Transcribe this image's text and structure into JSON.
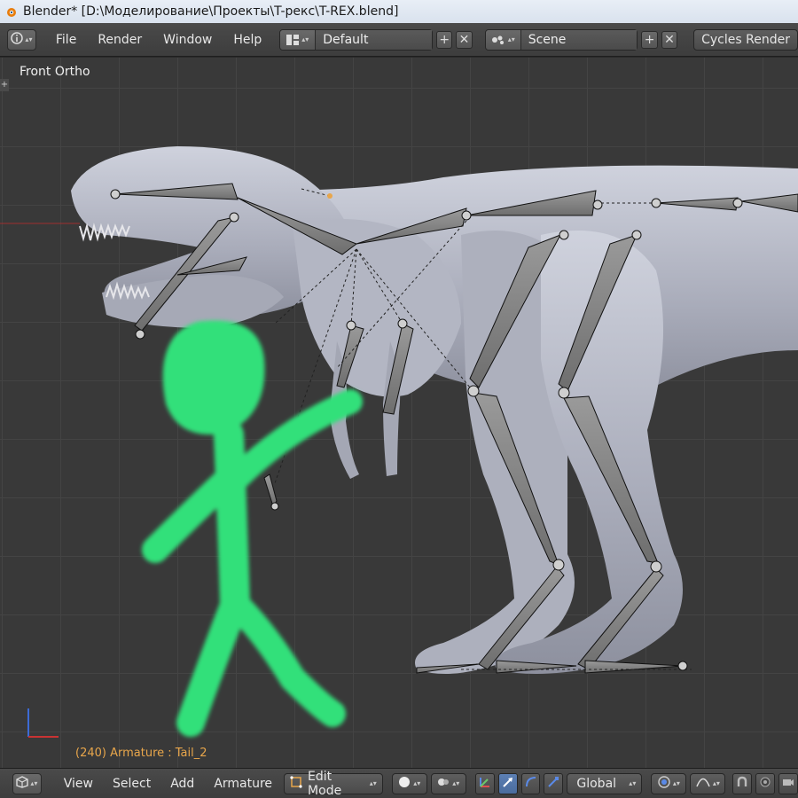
{
  "window": {
    "title": "Blender* [D:\\Моделирование\\Проекты\\T-рекс\\T-REX.blend]"
  },
  "top_menu": {
    "items": [
      "File",
      "Render",
      "Window",
      "Help"
    ],
    "screen_layout": "Default",
    "scene": "Scene",
    "render_engine": "Cycles Render"
  },
  "viewport": {
    "view_name": "Front Ortho",
    "object_info": "(240) Armature : Tail_2"
  },
  "bottom_header": {
    "menu": [
      "View",
      "Select",
      "Add",
      "Armature"
    ],
    "mode": "Edit Mode",
    "transform_orientation": "Global"
  },
  "colors": {
    "accent_blue": "#5c7fb3",
    "object_info": "#e8a64b",
    "stick_figure": "#33e07a",
    "bone": "#8a8a8a",
    "mesh": "#b9bcc8"
  }
}
